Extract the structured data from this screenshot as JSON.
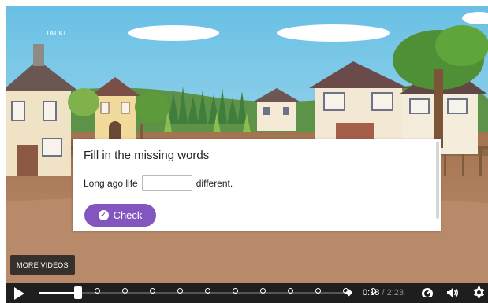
{
  "logo": "TALKI",
  "quiz": {
    "title": "Fill in the missing words",
    "sentence_before": "Long ago life",
    "blank_value": "",
    "sentence_after": "different.",
    "check_label": "Check"
  },
  "more_videos_label": "MORE VIDEOS",
  "player": {
    "current_time": "0:18",
    "separator": " / ",
    "total_time": "2:23",
    "progress": 0.126,
    "marker_count": 11
  },
  "colors": {
    "accent": "#8356bf",
    "controls_bg": "#1e1e1e"
  },
  "icons": [
    "play-icon",
    "check-icon",
    "end-marker-icon",
    "speed-icon",
    "volume-icon",
    "gear-icon"
  ]
}
